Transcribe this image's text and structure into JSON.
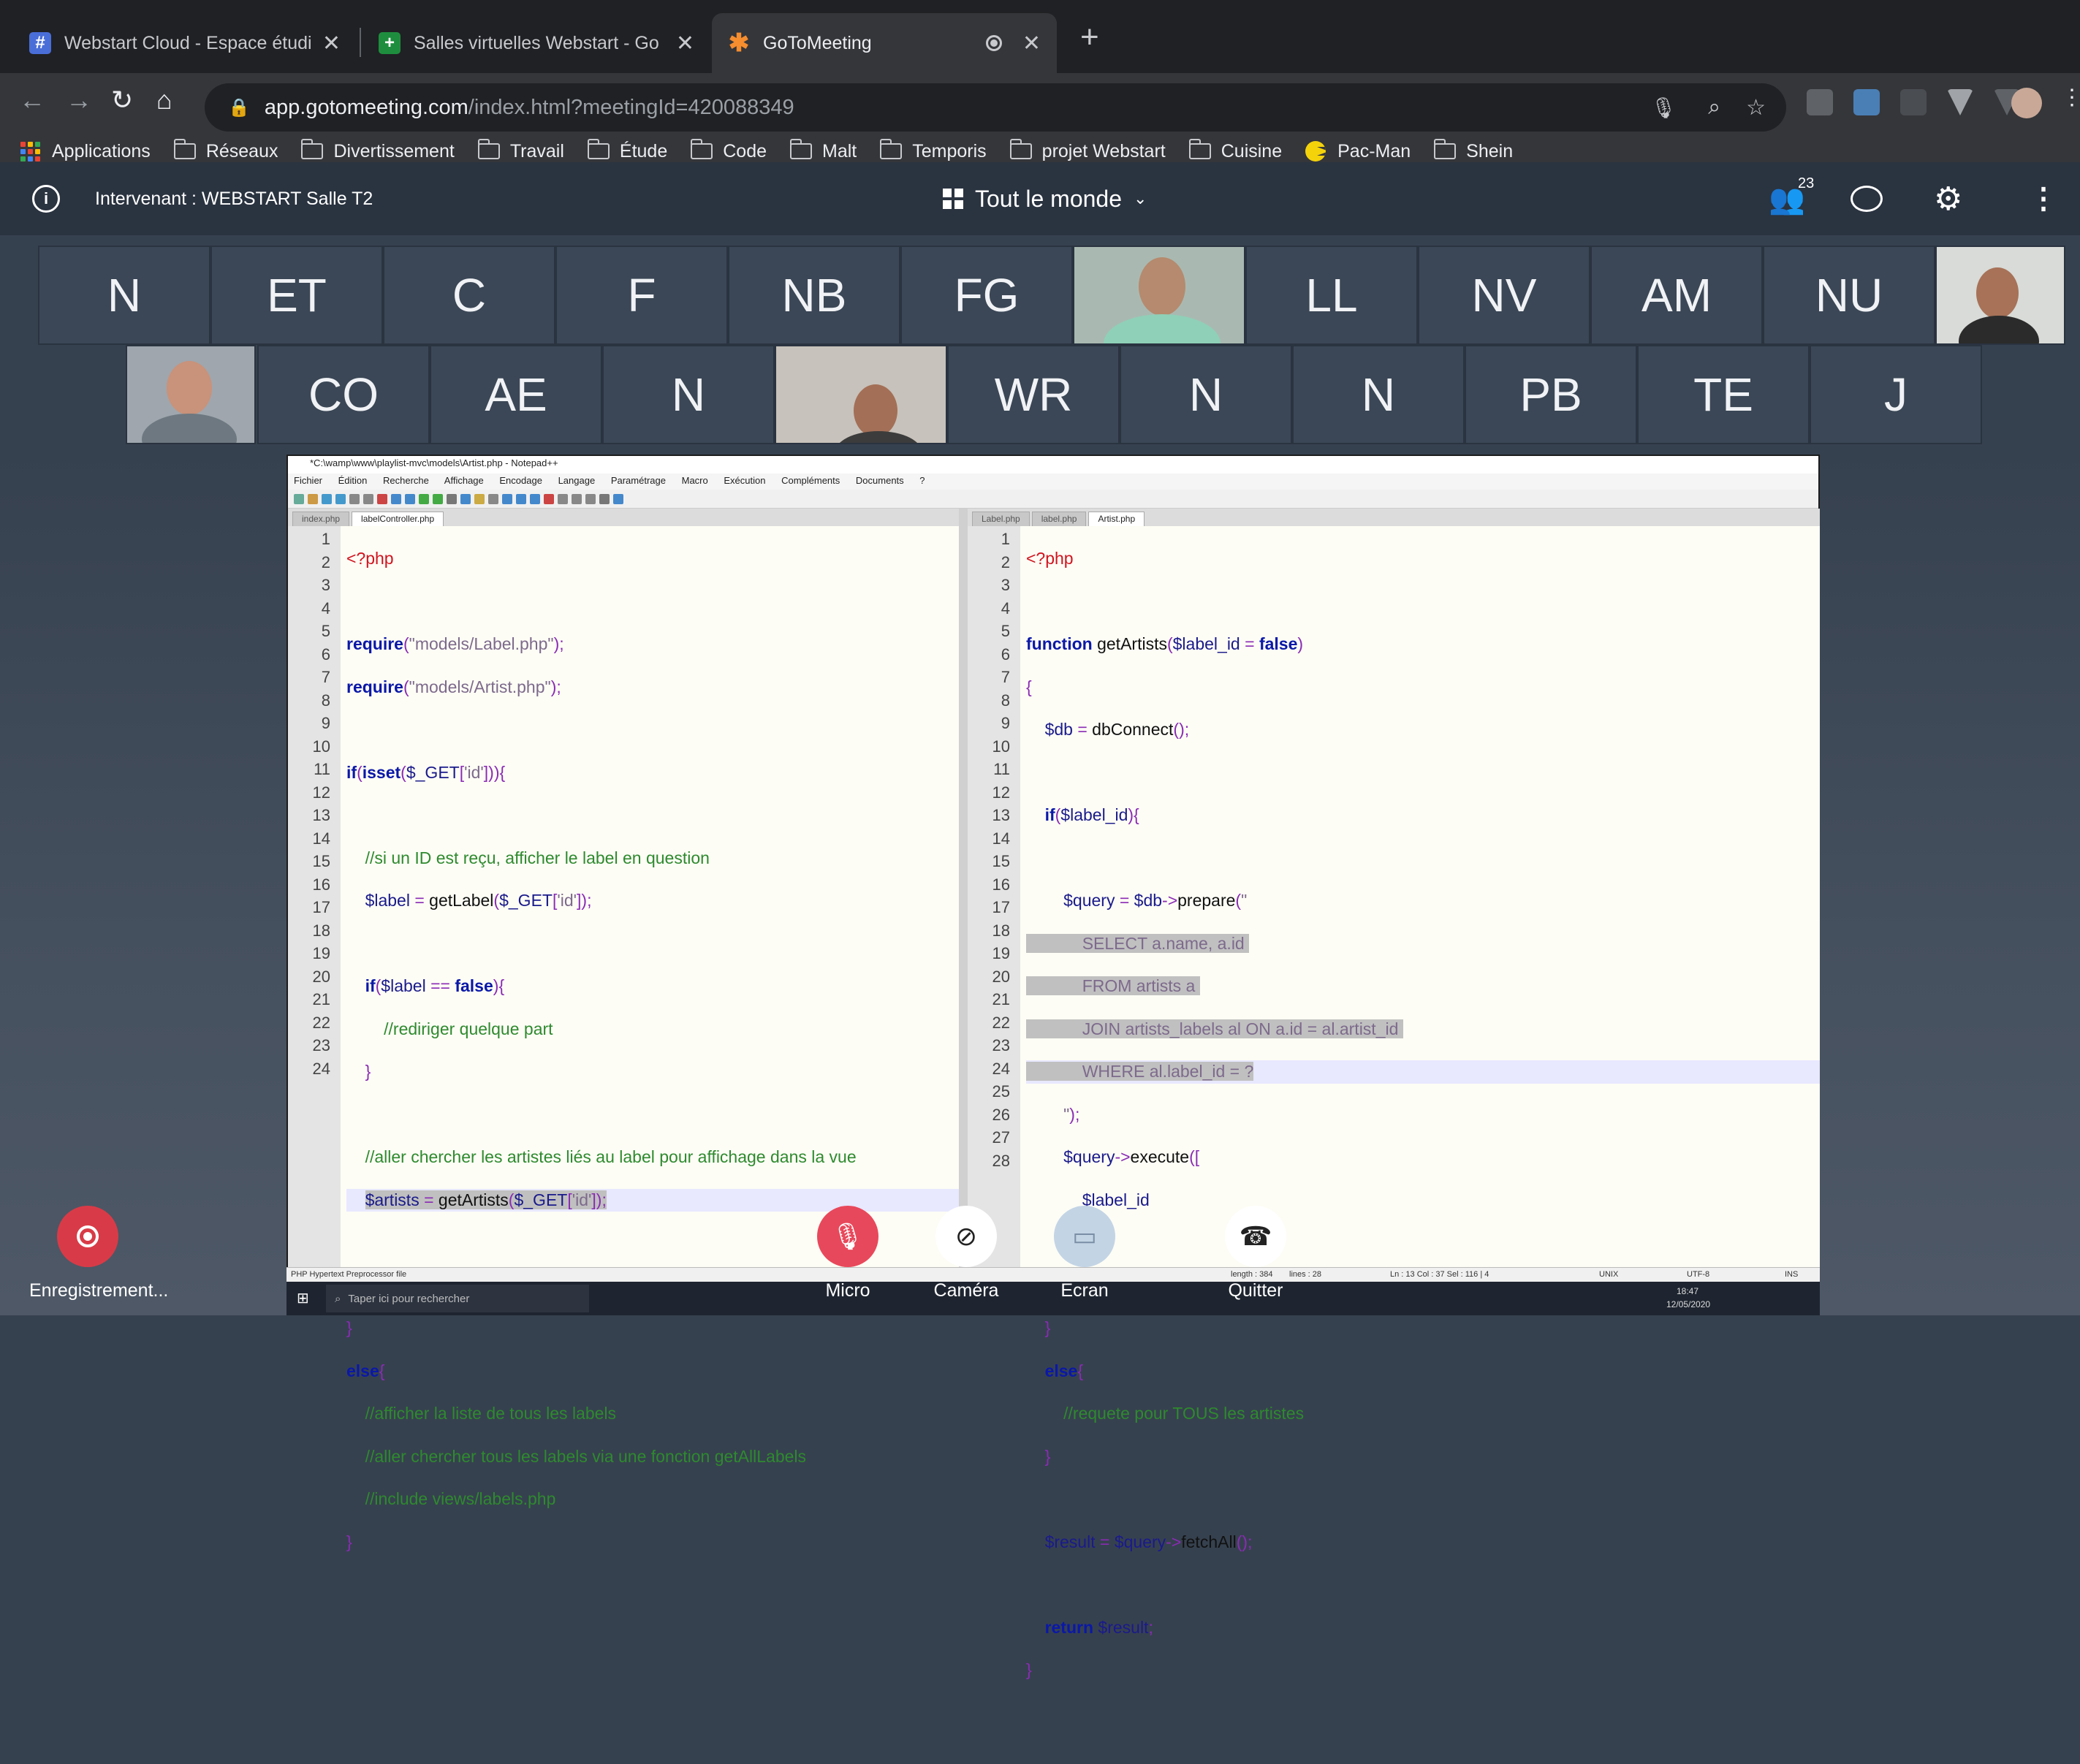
{
  "browser": {
    "tabs": [
      {
        "title": "Webstart Cloud - Espace étudi",
        "favicon": "hash-icon",
        "color": "#4a6ed8"
      },
      {
        "title": "Salles virtuelles Webstart - Go",
        "favicon": "sheets-icon",
        "color": "#1e8e3e"
      },
      {
        "title": "GoToMeeting",
        "favicon": "gotomeeting-icon",
        "color": "#f68d2e"
      }
    ],
    "url_host": "app.gotomeeting.com",
    "url_path": "/index.html?meetingId=420088349",
    "bookmarks": [
      "Applications",
      "Réseaux",
      "Divertissement",
      "Travail",
      "Étude",
      "Code",
      "Malt",
      "Temporis",
      "projet Webstart",
      "Cuisine",
      "Pac-Man",
      "Shein"
    ]
  },
  "meeting": {
    "presenter": "Intervenant : WEBSTART Salle T2",
    "view": "Tout le monde",
    "participants_count": "23",
    "tiles_row1": [
      "N",
      "ET",
      "C",
      "F",
      "NB",
      "FG",
      "",
      "LL",
      "NV",
      "AM",
      "NU",
      ""
    ],
    "tiles_row2": [
      "",
      "CO",
      "AE",
      "N",
      "",
      "WR",
      "N",
      "N",
      "PB",
      "TE",
      "J"
    ],
    "controls": {
      "record": "Enregistrement...",
      "micro": "Micro",
      "camera": "Caméra",
      "screen": "Ecran",
      "quit": "Quitter"
    }
  },
  "notepad": {
    "title": "*C:\\wamp\\www\\playlist-mvc\\models\\Artist.php - Notepad++",
    "menu": [
      "Fichier",
      "Édition",
      "Recherche",
      "Affichage",
      "Encodage",
      "Langage",
      "Paramétrage",
      "Macro",
      "Exécution",
      "Compléments",
      "Documents",
      "?"
    ],
    "left_tabs": [
      "index.php",
      "labelController.php"
    ],
    "right_tabs": [
      "Label.php",
      "label.php",
      "Artist.php"
    ],
    "status": {
      "type": "PHP Hypertext Preprocessor file",
      "length": "length : 384",
      "lines": "lines : 28",
      "pos": "Ln : 13    Col : 37    Sel : 116 | 4",
      "eol": "UNIX",
      "enc": "UTF-8",
      "ins": "INS"
    },
    "taskbar": {
      "search": "Taper ici pour rechercher",
      "time": "18:47",
      "date": "12/05/2020"
    }
  }
}
